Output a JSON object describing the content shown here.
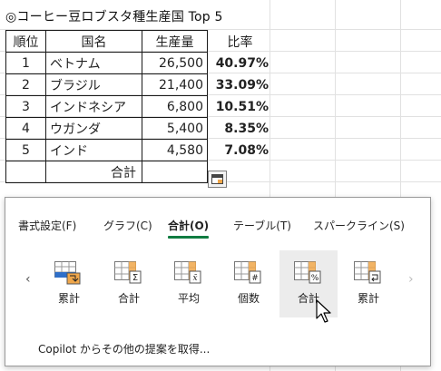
{
  "sheet": {
    "title": "◎コーヒー豆ロブスタ種生産国 Top 5",
    "headers": {
      "rank": "順位",
      "name": "国名",
      "production": "生産量",
      "ratio": "比率"
    },
    "rows": [
      {
        "rank": "1",
        "name": "ベトナム",
        "production": "26,500",
        "ratio": "40.97%"
      },
      {
        "rank": "2",
        "name": "ブラジル",
        "production": "21,400",
        "ratio": "33.09%"
      },
      {
        "rank": "3",
        "name": "インドネシア",
        "production": "6,800",
        "ratio": "10.51%"
      },
      {
        "rank": "4",
        "name": "ウガンダ",
        "production": "5,400",
        "ratio": "8.35%"
      },
      {
        "rank": "5",
        "name": "インド",
        "production": "4,580",
        "ratio": "7.08%"
      }
    ],
    "total_label": "合計"
  },
  "quick_analysis": {
    "tabs": [
      {
        "label": "書式設定(F)",
        "active": false
      },
      {
        "label": "グラフ(C)",
        "active": false
      },
      {
        "label": "合計(O)",
        "active": true
      },
      {
        "label": "テーブル(T)",
        "active": false
      },
      {
        "label": "スパークライン(S)",
        "active": false
      }
    ],
    "nav": {
      "left": "‹",
      "right": "›"
    },
    "items": [
      {
        "label": "累計",
        "icon": "running-total-column-icon"
      },
      {
        "label": "合計",
        "icon": "sum-row-icon"
      },
      {
        "label": "平均",
        "icon": "average-row-icon"
      },
      {
        "label": "個数",
        "icon": "count-row-icon"
      },
      {
        "label": "合計",
        "icon": "percent-total-row-icon"
      },
      {
        "label": "累計",
        "icon": "running-total-row-icon"
      }
    ],
    "copilot_link": "Copilot からその他の提案を取得..."
  },
  "colors": {
    "accent_green": "#107c41",
    "icon_orange": "#f0a74a",
    "icon_blue": "#2f6fc8"
  }
}
